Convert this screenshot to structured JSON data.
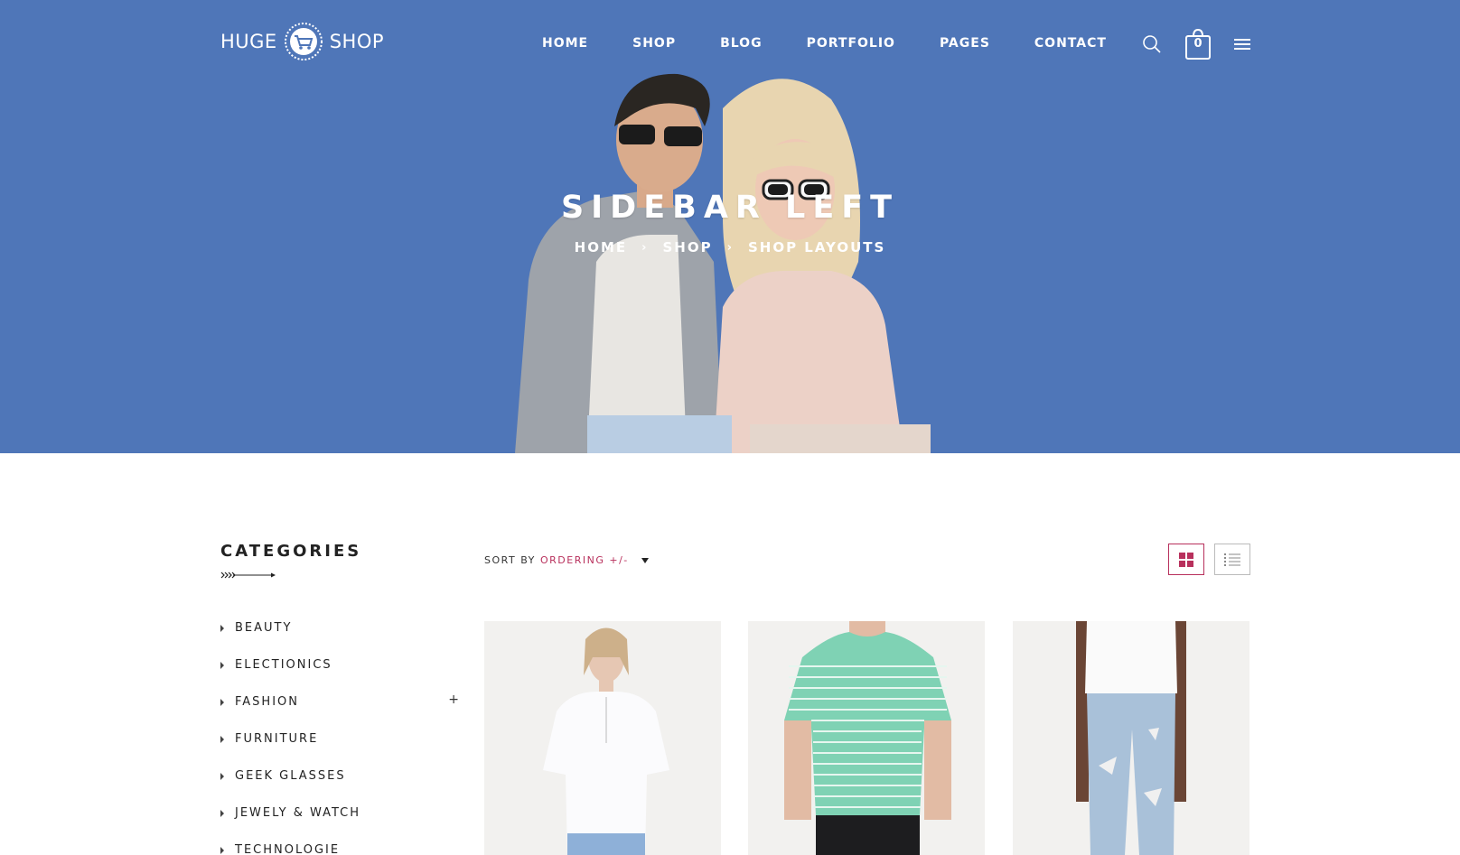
{
  "brand": {
    "left": "HUGE",
    "right": "SHOP"
  },
  "nav": {
    "items": [
      "HOME",
      "SHOP",
      "BLOG",
      "PORTFOLIO",
      "PAGES",
      "CONTACT"
    ],
    "cart_count": "0"
  },
  "hero": {
    "title": "SIDEBAR LEFT",
    "breadcrumb": [
      "HOME",
      "SHOP",
      "SHOP LAYOUTS"
    ]
  },
  "sidebar": {
    "title": "CATEGORIES",
    "categories": [
      "BEAUTY",
      "ELECTIONICS",
      "FASHION",
      "FURNITURE",
      "GEEK GLASSES",
      "JEWELY & WATCH",
      "TECHNOLOGIE"
    ],
    "expand_symbol": "+"
  },
  "toolbar": {
    "sort_label": "SORT BY",
    "sort_value": "ORDERING +/-"
  },
  "colors": {
    "hero_bg": "#4f76b8",
    "accent": "#b8305c",
    "text": "#222222"
  },
  "icons": {
    "search": "search-icon",
    "cart": "shopping-bag-icon",
    "menu": "hamburger-menu-icon",
    "grid": "grid-view-icon",
    "list": "list-view-icon"
  }
}
